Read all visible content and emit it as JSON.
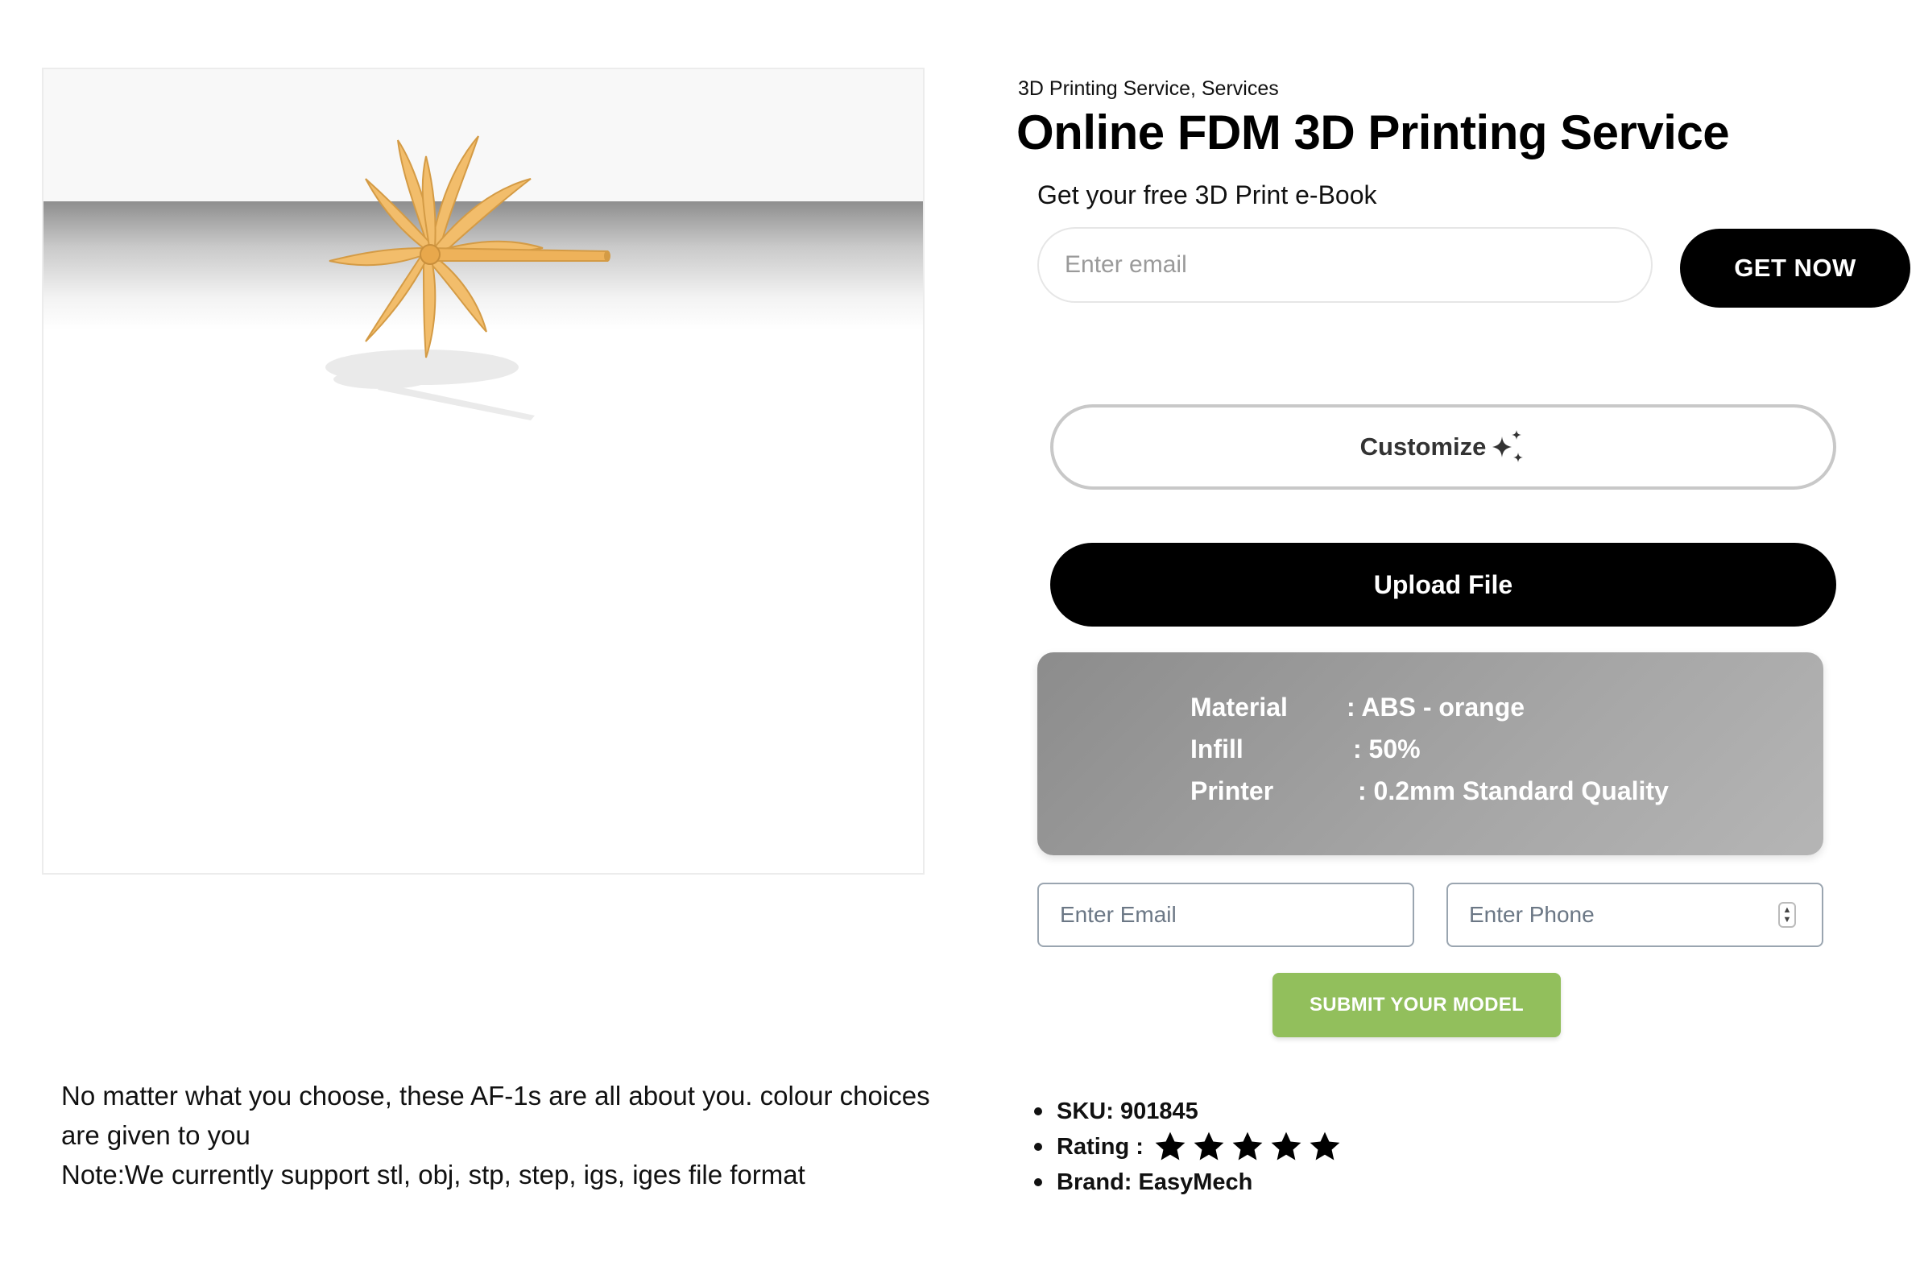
{
  "product": {
    "category": "3D Printing Service, Services",
    "title": "Online FDM 3D Printing Service"
  },
  "ebook": {
    "label": "Get your free 3D Print e-Book",
    "email_placeholder": "Enter email",
    "button_label": "GET NOW"
  },
  "actions": {
    "customize_label": "Customize",
    "upload_label": "Upload File"
  },
  "specs": [
    {
      "key": "Material",
      "value": ": ABS - orange"
    },
    {
      "key": "Infill",
      "value": ": 50%"
    },
    {
      "key": "Printer",
      "value": ": 0.2mm Standard Quality"
    }
  ],
  "contact_form": {
    "email_placeholder": "Enter Email",
    "phone_placeholder": "Enter Phone",
    "submit_label": "SUBMIT YOUR MODEL"
  },
  "description": {
    "text": "No matter what you choose, these AF-1s are all about you. colour choices are given to you",
    "note": "Note:We currently support stl, obj, stp, step, igs, iges file format"
  },
  "meta": {
    "sku": "SKU: 901845",
    "rating_label": "Rating :",
    "rating_value": 5,
    "rating_max": 5,
    "brand": "Brand: EasyMech"
  },
  "colors": {
    "model": "#f2bd6b",
    "button_dark": "#000000",
    "submit_green": "#92bf5c",
    "spec_panel": "#a0a0a0"
  },
  "icons": {
    "customize": "sparkle-icon",
    "rating": "star-icon",
    "phone_spinner": "spinner-icon"
  }
}
